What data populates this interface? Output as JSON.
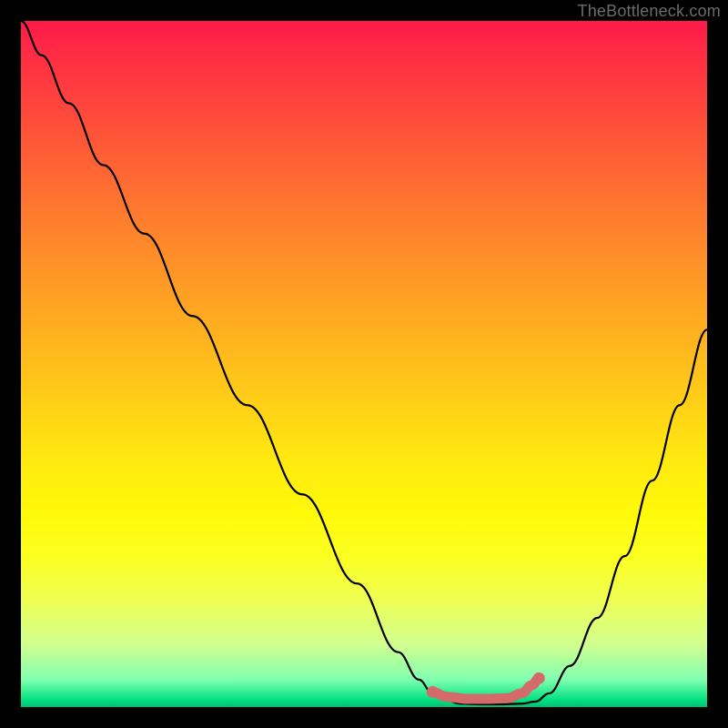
{
  "watermark": "TheBottleneck.com",
  "chart_data": {
    "type": "line",
    "title": "",
    "xlabel": "",
    "ylabel": "",
    "xlim": [
      0,
      100
    ],
    "ylim": [
      0,
      100
    ],
    "grid": false,
    "series": [
      {
        "name": "curve",
        "color": "#000000",
        "x": [
          0,
          3,
          7,
          12,
          18,
          25,
          33,
          41,
          49,
          55,
          58,
          60,
          62,
          64,
          67,
          70,
          73,
          75,
          77,
          80,
          84,
          88,
          92,
          96,
          100
        ],
        "y": [
          100,
          95,
          88,
          79,
          69,
          57,
          44,
          31,
          18,
          8,
          4,
          2,
          1,
          0.5,
          0.4,
          0.4,
          0.5,
          0.8,
          2,
          6,
          13,
          22,
          33,
          44,
          55
        ]
      },
      {
        "name": "optimal-band",
        "color": "#d46a6a",
        "x": [
          60,
          62,
          65,
          68,
          71,
          73,
          74.5,
          75.5
        ],
        "y": [
          2.2,
          1.5,
          1.2,
          1.2,
          1.3,
          2.0,
          3.2,
          4.2
        ]
      }
    ],
    "markers": [
      {
        "name": "optimal-start-dot",
        "x": 60,
        "y": 2.2,
        "color": "#d46a6a"
      },
      {
        "name": "optimal-end-dot",
        "x": 75.5,
        "y": 4.2,
        "color": "#d46a6a"
      }
    ]
  }
}
